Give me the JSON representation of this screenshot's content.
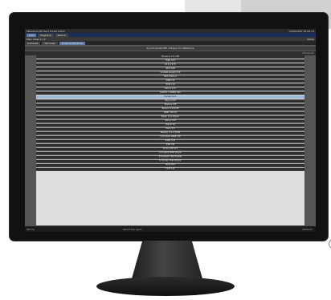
{
  "window": {
    "title": "Milestone XProtect Smart Client",
    "clock": "11/06/2012 10:02:11"
  },
  "menu": {
    "items": [
      "Live",
      "Playback",
      "Search"
    ]
  },
  "toolbar": {
    "view": "Main View 2 x 2",
    "setup": "Setup"
  },
  "tabs": [
    "Cameras",
    "Windows",
    "Floating Windows"
  ],
  "panel": {
    "title": "Synchronized PIP / Plug-in for Milestone",
    "right": "Advanced"
  },
  "rows": [
    "Muxes & 10.1.88",
    "FAB1 S73",
    "IB 5.4 S73",
    "IIDE CAM",
    "Sm/Met Gadpel CIP",
    "DEA Praha 4",
    "MNE CIP",
    "HVSI 1 IP",
    "Paloci S73",
    "SLOOS 1 OMEN 19h",
    "Pryvek 4.LS",
    "Milyna CIP",
    "Ztewny CIP",
    "Bozaci 4.9.8 CIP",
    "Z2B1 CIP D1",
    "Bylen Line Player",
    "SKoux CIP",
    "Diacel S2",
    "Perla 3.5",
    "Maselu 1 a 1 CCAE",
    "S Contact OMIE CIP",
    "Z2B1 S73",
    "Z2B CIP",
    "Podvo IPP S73",
    "S Contact DMX Player",
    "S Contact TNK Hostile",
    "S Contact TNK Player",
    "Perla S73",
    "FCIE 1a2"
  ],
  "selected_index": 10,
  "status": {
    "left": "Set up",
    "mid": "Select the input",
    "right": "Network"
  }
}
